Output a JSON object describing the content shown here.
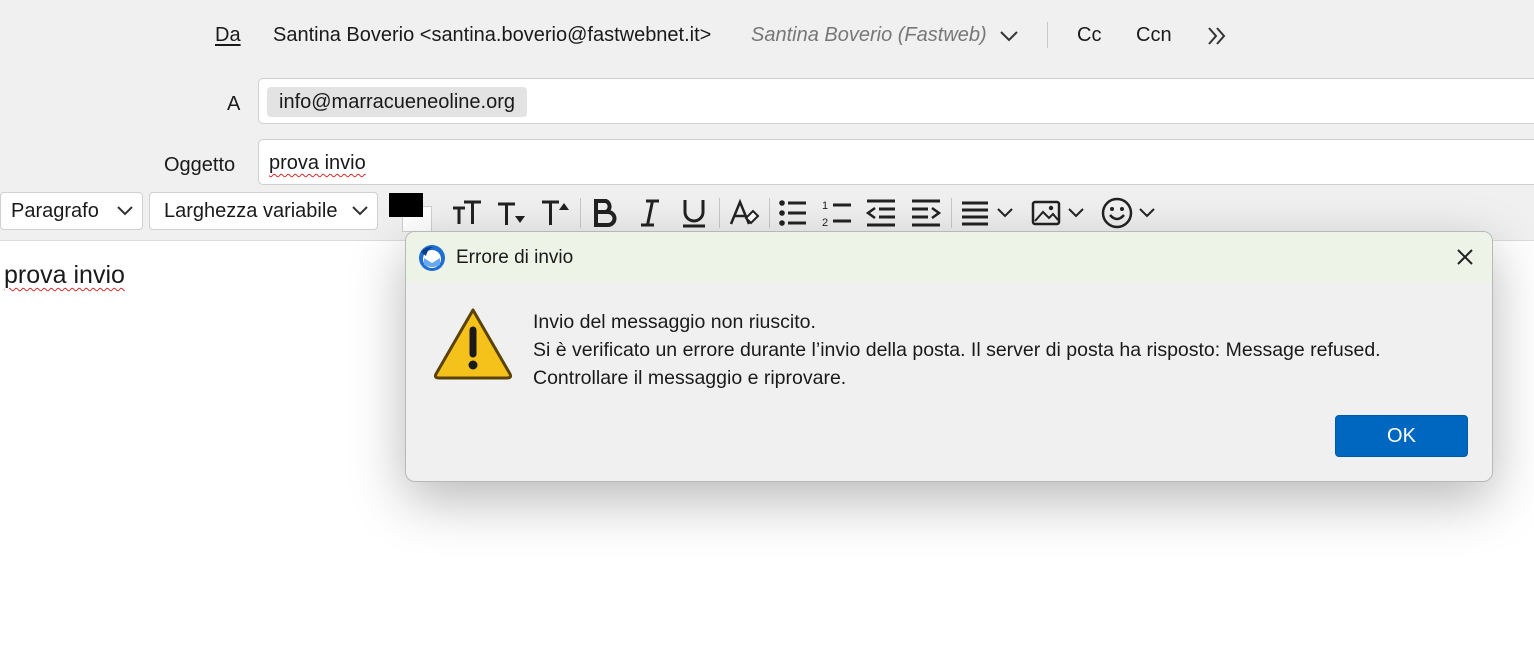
{
  "header": {
    "from_label": "Da",
    "from_value": "Santina Boverio <santina.boverio@fastwebnet.it>",
    "from_identity": "Santina Boverio (Fastweb)",
    "cc_label": "Cc",
    "bcc_label": "Ccn",
    "to_label": "A",
    "to_recipient": "info@marracueneoline.org",
    "subject_label": "Oggetto",
    "subject_value": "prova invio"
  },
  "toolbar": {
    "paragraph_format": "Paragrafo",
    "font_width": "Larghezza variabile",
    "text_color": "#000000",
    "icons": [
      "text-size-icon",
      "decrease-font-icon",
      "increase-font-icon",
      "bold-icon",
      "italic-icon",
      "underline-icon",
      "remove-format-icon",
      "bullet-list-icon",
      "numbered-list-icon",
      "outdent-icon",
      "indent-icon",
      "align-icon",
      "insert-image-icon",
      "emoji-icon"
    ]
  },
  "body": {
    "text": "prova invio"
  },
  "dialog": {
    "title": "Errore di invio",
    "message_line1": "Invio del messaggio non riuscito.",
    "message_line2": "Si è verificato un errore durante l’invio della posta. Il server di posta ha risposto: Message refused.",
    "message_line3": "Controllare il messaggio e riprovare.",
    "ok_label": "OK",
    "accent_color": "#0067c0"
  }
}
